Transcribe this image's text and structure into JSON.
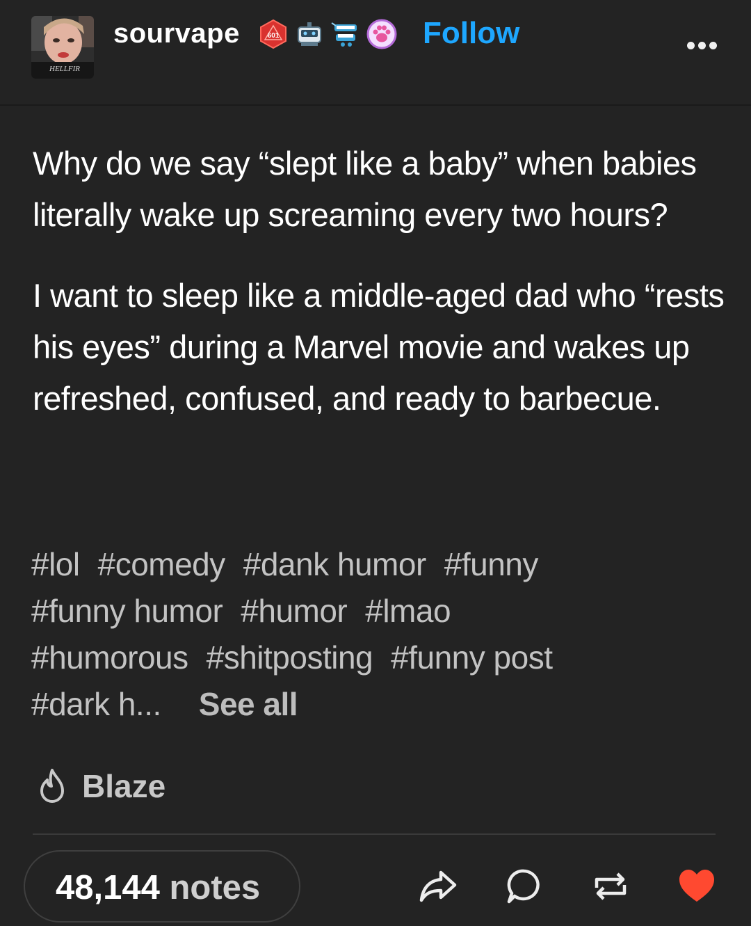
{
  "post": {
    "username": "sourvape",
    "follow_label": "Follow",
    "avatar_text": "HELLFIR",
    "badges": [
      {
        "icon": "d20-dice-badge-icon",
        "text": "601",
        "color": "#d9322f"
      },
      {
        "icon": "robot-badge-icon"
      },
      {
        "icon": "chattering-teeth-badge-icon"
      },
      {
        "icon": "paw-print-badge-icon",
        "color": "#e7a3ff"
      }
    ],
    "more_icon": "more-options-icon",
    "paragraphs": [
      "Why do we say “slept like a baby” when babies literally wake up screaming every two hours?",
      "I want to sleep like a middle-aged dad who “rests his eyes” during a Marvel movie and wakes up refreshed, confused, and ready to barbecue."
    ],
    "tags": [
      "#lol",
      "#comedy",
      "#dank humor",
      "#funny",
      "#funny humor",
      "#humor",
      "#lmao",
      "#humorous",
      "#shitposting",
      "#funny post",
      "#dark h..."
    ],
    "see_all_label": "See all",
    "blaze_label": "Blaze",
    "notes_count": "48,144",
    "notes_label": "notes",
    "actions": [
      {
        "name": "share-icon"
      },
      {
        "name": "reply-icon"
      },
      {
        "name": "reblog-icon"
      },
      {
        "name": "like-heart-icon",
        "color": "#ff4930"
      }
    ],
    "colors": {
      "background": "#232323",
      "accent": "#1ea7ff",
      "like": "#ff4930",
      "tag_text": "#c3c3c3"
    }
  }
}
